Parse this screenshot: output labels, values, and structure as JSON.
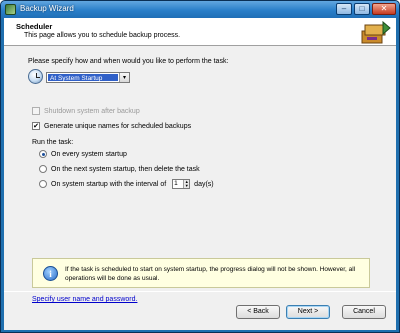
{
  "window": {
    "title": "Backup Wizard",
    "min": "–",
    "max": "□",
    "close": "✕"
  },
  "header": {
    "title": "Scheduler",
    "subtitle": "This page allows you to schedule backup process."
  },
  "prompt": "Please specify how and when would you like to perform the task:",
  "schedule_type": {
    "selected": "At System Startup",
    "arrow": "▾"
  },
  "options": {
    "shutdown": {
      "label": "Shutdown system after backup",
      "checked": false,
      "enabled": false
    },
    "unique_names": {
      "label": "Generate unique names for scheduled backups",
      "checked": true,
      "check_mark": "✔"
    }
  },
  "run": {
    "label": "Run the task:",
    "choices": [
      {
        "label": "On every system startup",
        "checked": true
      },
      {
        "label": "On the next system startup, then delete the task",
        "checked": false
      },
      {
        "label": "On system startup with the interval of",
        "checked": false
      }
    ],
    "interval_value": "1",
    "interval_unit": "day(s)",
    "spin_up": "▲",
    "spin_down": "▼"
  },
  "info": {
    "icon_glyph": "i",
    "text": "If the task is scheduled to start on system startup, the progress dialog will not be shown. However, all operations will be done as usual."
  },
  "link": "Specify user name and password.",
  "buttons": {
    "back": "< Back",
    "next": "Next >",
    "cancel": "Cancel"
  }
}
